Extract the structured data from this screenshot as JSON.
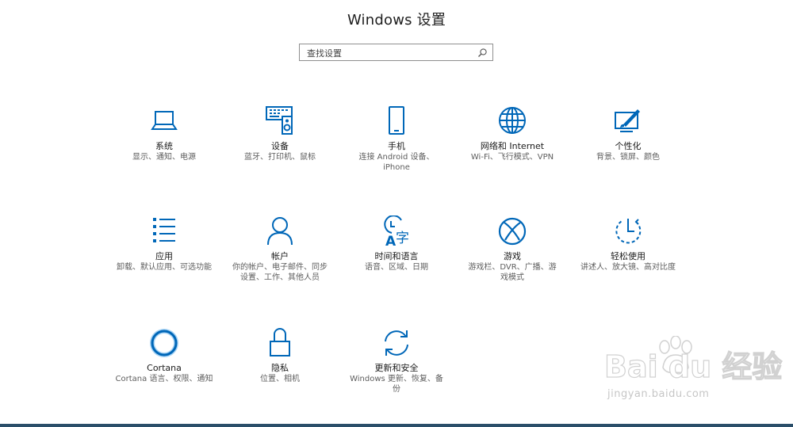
{
  "window": {
    "title": "Windows 设置"
  },
  "search": {
    "placeholder": "查找设置",
    "icon": "search-icon"
  },
  "accent": "#0067b8",
  "tiles": [
    {
      "label": "系统",
      "desc": "显示、通知、电源",
      "icon": "laptop-icon"
    },
    {
      "label": "设备",
      "desc": "蓝牙、打印机、鼠标",
      "icon": "keyboard-speaker-icon"
    },
    {
      "label": "手机",
      "desc": "连接 Android 设备、iPhone",
      "icon": "phone-icon"
    },
    {
      "label": "网络和 Internet",
      "desc": "Wi-Fi、飞行模式、VPN",
      "icon": "globe-icon"
    },
    {
      "label": "个性化",
      "desc": "背景、锁屏、颜色",
      "icon": "paint-monitor-icon"
    },
    {
      "label": "应用",
      "desc": "卸载、默认应用、可选功能",
      "icon": "list-icon"
    },
    {
      "label": "帐户",
      "desc": "你的帐户、电子邮件、同步设置、工作、其他人员",
      "icon": "person-icon"
    },
    {
      "label": "时间和语言",
      "desc": "语音、区域、日期",
      "icon": "time-language-icon"
    },
    {
      "label": "游戏",
      "desc": "游戏栏、DVR、广播、游戏模式",
      "icon": "xbox-icon"
    },
    {
      "label": "轻松使用",
      "desc": "讲述人、放大镜、高对比度",
      "icon": "ease-of-access-icon"
    },
    {
      "label": "Cortana",
      "desc": "Cortana 语言、权限、通知",
      "icon": "cortana-icon"
    },
    {
      "label": "隐私",
      "desc": "位置、相机",
      "icon": "lock-icon"
    },
    {
      "label": "更新和安全",
      "desc": "Windows 更新、恢复、备份",
      "icon": "sync-icon"
    }
  ],
  "watermark": {
    "brand": "Bai du 经验",
    "url": "jingyan.baidu.com"
  }
}
